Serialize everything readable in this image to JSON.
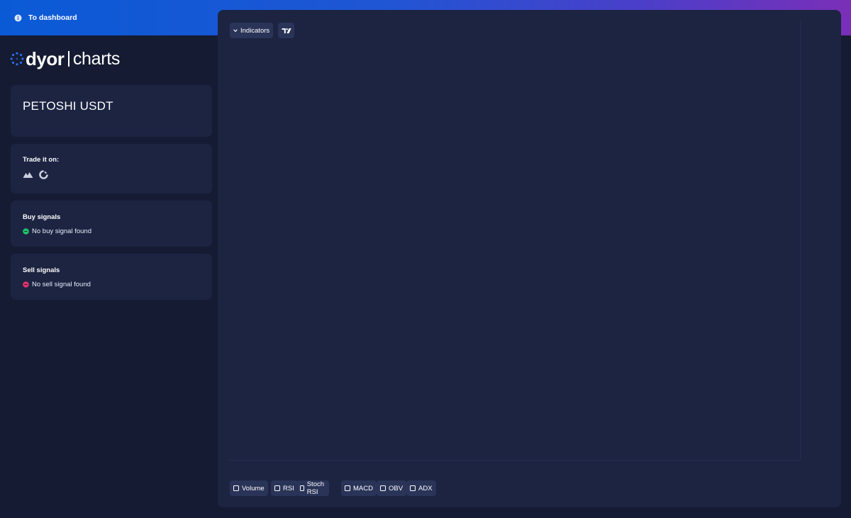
{
  "header": {
    "back_label": "To dashboard",
    "back_icon": "info-circle-icon"
  },
  "logo": {
    "brand": "dyor",
    "sub": "charts",
    "icon": "dotted-circle-logo-icon",
    "accent_color": "#2b6cf0"
  },
  "pair": {
    "symbol": "PETOSHI USDT"
  },
  "trade": {
    "heading": "Trade it on:",
    "exchanges": [
      "mountain-exchange-icon",
      "circle-arrow-exchange-icon"
    ]
  },
  "buy_signals": {
    "heading": "Buy signals",
    "status": "No buy signal found",
    "dot_color": "#1fc26b"
  },
  "sell_signals": {
    "heading": "Sell signals",
    "status": "No sell signal found",
    "dot_color": "#e0336e"
  },
  "chart": {
    "indicators_label": "Indicators",
    "tradingview_icon": "tradingview-logo-icon",
    "toggles": [
      {
        "label": "Volume",
        "checked": false
      },
      {
        "label": "RSI",
        "checked": false
      },
      {
        "label": "Stoch RSI",
        "checked": false
      },
      {
        "label": "MACD",
        "checked": false
      },
      {
        "label": "OBV",
        "checked": false
      },
      {
        "label": "ADX",
        "checked": false
      }
    ]
  }
}
